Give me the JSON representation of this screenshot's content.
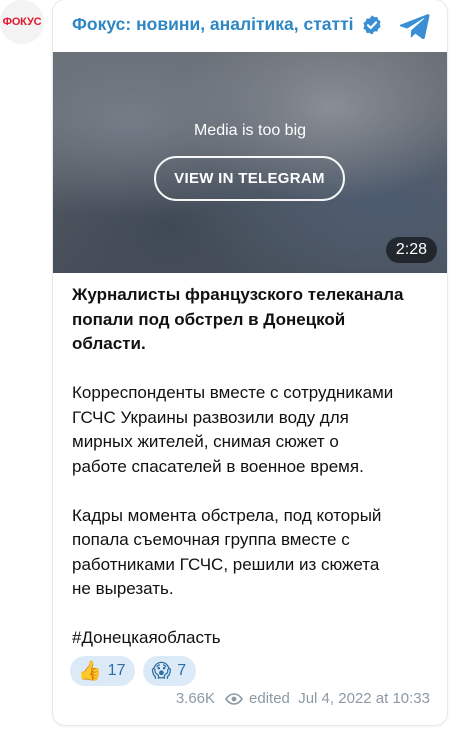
{
  "channel": {
    "avatar_text": "ФОКУС",
    "title": "Фокус: новини, аналітика, статті"
  },
  "media": {
    "notice": "Media is too big",
    "button_label": "VIEW IN TELEGRAM",
    "duration": "2:28"
  },
  "post": {
    "headline_lines": [
      "Журналисты французского телеканала",
      "попали под обстрел в Донецкой",
      "области."
    ],
    "paragraph1_lines": [
      "Корреспонденты вместе с сотрудниками",
      "ГСЧС Украины развозили воду для",
      "мирных жителей, снимая сюжет о",
      "работе спасателей в военное время."
    ],
    "paragraph2_lines": [
      "Кадры момента обстрела, под который",
      "попала съемочная группа вместе с",
      "работниками ГСЧС, решили из сюжета",
      "не вырезать."
    ],
    "hashtag": "#Донецкаяобласть"
  },
  "reactions": [
    {
      "emoji": "👍",
      "count": "17"
    },
    {
      "emoji": "😱",
      "count": "7"
    }
  ],
  "footer": {
    "views": "3.66K",
    "edited": "edited  Jul 4, 2022 at 10:33"
  },
  "colors": {
    "accent": "#2e87c4",
    "meta": "#8c9aa6",
    "reaction_bg": "#dceaf7"
  },
  "icons": {
    "verified": "verified-badge-icon",
    "telegram": "telegram-plane-icon",
    "views": "eye-icon"
  }
}
